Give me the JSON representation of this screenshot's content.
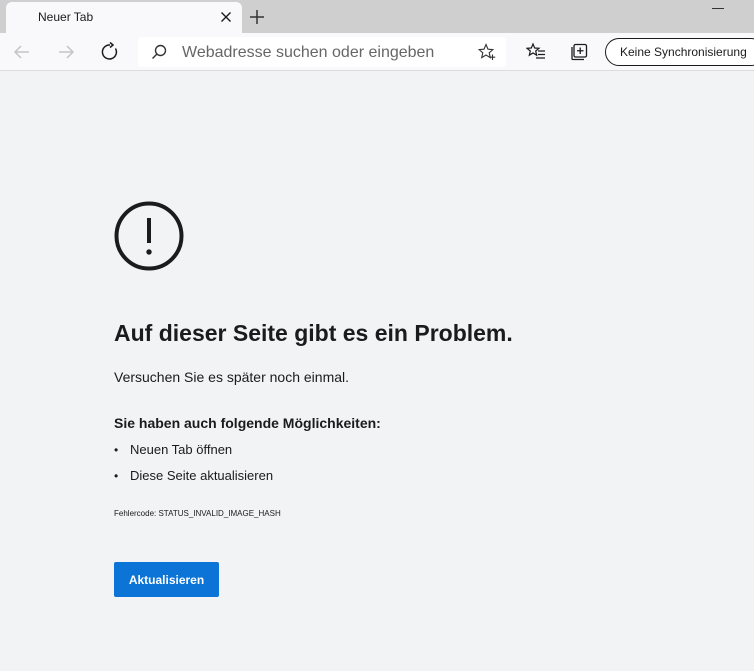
{
  "tab": {
    "title": "Neuer Tab"
  },
  "toolbar": {
    "address_placeholder": "Webadresse suchen oder eingeben",
    "sync_label": "Keine Synchronisierung"
  },
  "error_page": {
    "headline": "Auf dieser Seite gibt es ein Problem.",
    "subtext": "Versuchen Sie es später noch einmal.",
    "options_heading": "Sie haben auch folgende Möglichkeiten:",
    "options": [
      "Neuen Tab öffnen",
      "Diese Seite aktualisieren"
    ],
    "error_code": "Fehlercode: STATUS_INVALID_IMAGE_HASH",
    "button_label": "Aktualisieren"
  },
  "colors": {
    "accent": "#0b74d6",
    "page_background": "#f2f3f5",
    "tabstrip": "#cfcfcf"
  },
  "icons": [
    "close-icon",
    "plus-icon",
    "back-arrow-icon",
    "forward-arrow-icon",
    "reload-icon",
    "search-icon",
    "star-add-icon",
    "favorites-icon",
    "collections-icon",
    "exclamation-circle-icon"
  ]
}
